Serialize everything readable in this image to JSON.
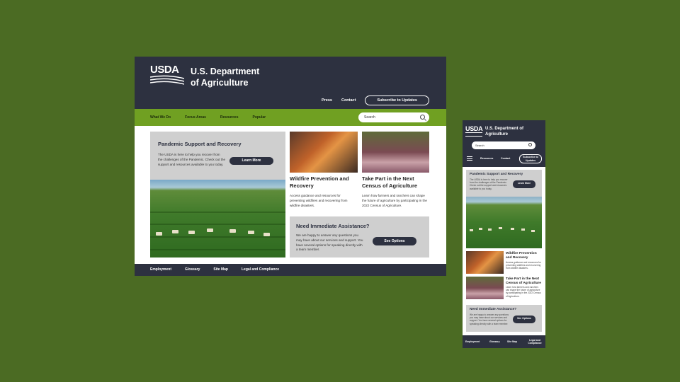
{
  "brand": {
    "logo_text": "USDA",
    "dept_line1": "U.S. Department",
    "dept_line2": "of Agriculture"
  },
  "utility": {
    "press": "Press",
    "contact": "Contact",
    "subscribe": "Subscribe to Updates"
  },
  "nav": [
    "What We Do",
    "Focus Areas",
    "Resources",
    "Popular"
  ],
  "search": {
    "placeholder": "Search"
  },
  "pandemic": {
    "title": "Pandemic Support and Recovery",
    "text": "The USDA is here to help you recover from the challenges of the Pandemic. Check out the support and resources available to you today.",
    "button": "Learn More"
  },
  "wildfire": {
    "title": "Wildfire Prevention and Recovery",
    "text": "Access guidance and resources for preventing wildfires and recovering from wildfire disasters."
  },
  "census": {
    "title": "Take Part in the Next Census of Agriculture",
    "text": "Learn how farmers and ranchers can shape the future of agriculture by participating in the 2022 Census of Agriculture."
  },
  "assistance": {
    "title": "Need Immediate Assistance?",
    "text": "We are happy to answer any questions you may have about our services and support. You have several options for speaking directly with a team member.",
    "button": "See Options"
  },
  "footer": [
    "Employment",
    "Glossary",
    "Site Map",
    "Legal and Compliance"
  ],
  "mobile": {
    "dept_line1": "U.S. Department of",
    "dept_line2": "Agriculture",
    "resources": "Resources",
    "contact": "Contact",
    "subscribe": "Subscribe to Updates",
    "wildfire_title": "Wildfire Prevention and Recovery",
    "census_title": "Take Part in the Next Census of Agriculture"
  },
  "colors": {
    "background": "#4b6b23",
    "header": "#2d3140",
    "nav_green": "#70a022",
    "card_gray": "#cfcfcf"
  }
}
